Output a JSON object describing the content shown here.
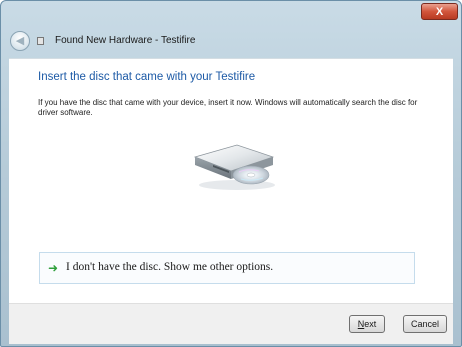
{
  "window": {
    "title": "Found New Hardware - Testifire",
    "close_label": "X"
  },
  "content": {
    "main_instruction": "Insert the disc that came with your Testifire",
    "body": "If you have the disc that came with your device, insert it now.  Windows will automatically search the disc for driver software.",
    "illustration_icon": "optical-drive-icon"
  },
  "option": {
    "arrow_icon": "green-arrow-icon",
    "label": "I don't have the disc.  Show me other options."
  },
  "buttons": {
    "next_mnemonic": "N",
    "next_rest": "ext",
    "cancel": "Cancel"
  },
  "colors": {
    "instruction_blue": "#1d5aa6",
    "arrow_green": "#2e9f3a",
    "close_red": "#d2553c"
  }
}
